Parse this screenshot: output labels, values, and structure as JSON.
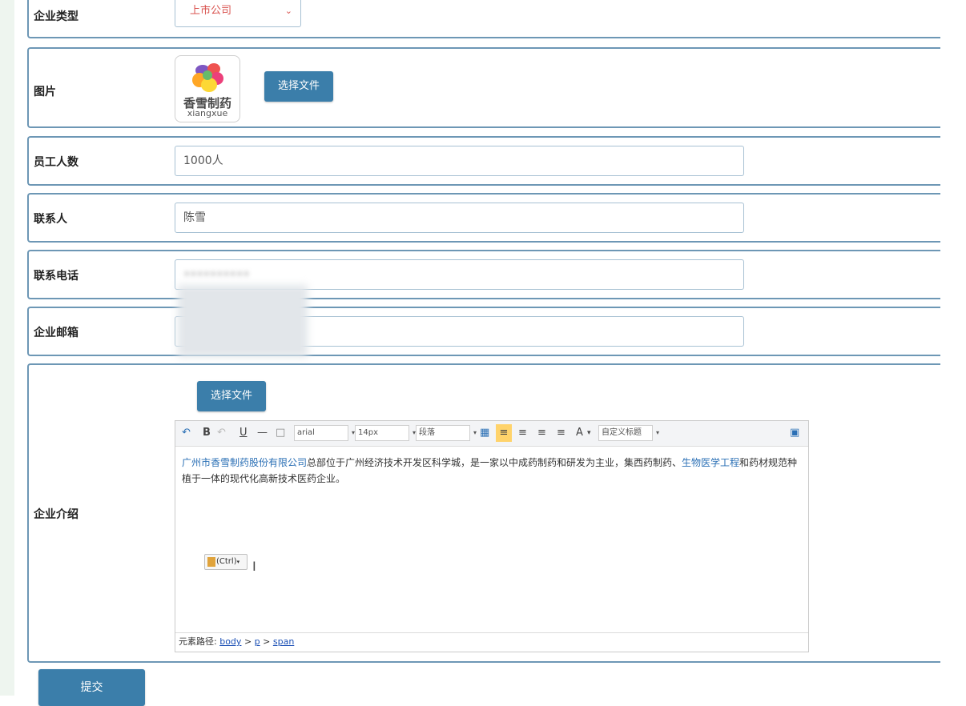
{
  "form": {
    "company_type": {
      "label": "企业类型",
      "value": "上市公司"
    },
    "image": {
      "label": "图片",
      "logo_text_cn": "香雪制药",
      "logo_text_en": "xiangxue",
      "choose_file": "选择文件"
    },
    "employees": {
      "label": "员工人数",
      "value": "1000人"
    },
    "contact": {
      "label": "联系人",
      "value": "陈雪"
    },
    "phone": {
      "label": "联系电话",
      "value": "••••••••••"
    },
    "email": {
      "label": "企业邮箱",
      "value": "•••••••••"
    },
    "intro": {
      "label": "企业介绍",
      "choose_file": "选择文件",
      "toolbar": {
        "font_family": "arial",
        "font_size": "14px",
        "paragraph": "段落",
        "custom_title": "自定义标题",
        "bold": "B",
        "underline": "U",
        "font_color": "A"
      },
      "content": {
        "link1": "广州市香雪制药股份有限公司",
        "text1": "总部位于广州经济技术开发区科学城，是一家以中成药制药和研发为主业，集西药制药、",
        "link2": "生物医学工程",
        "text2": "和药材规范种植于一体的现代化高新技术医药企业。"
      },
      "paste_hint": "(Ctrl)",
      "path_label": "元素路径:",
      "path_body": "body",
      "path_p": "p",
      "path_span": "span",
      "path_sep": ">"
    },
    "submit": "提交"
  }
}
